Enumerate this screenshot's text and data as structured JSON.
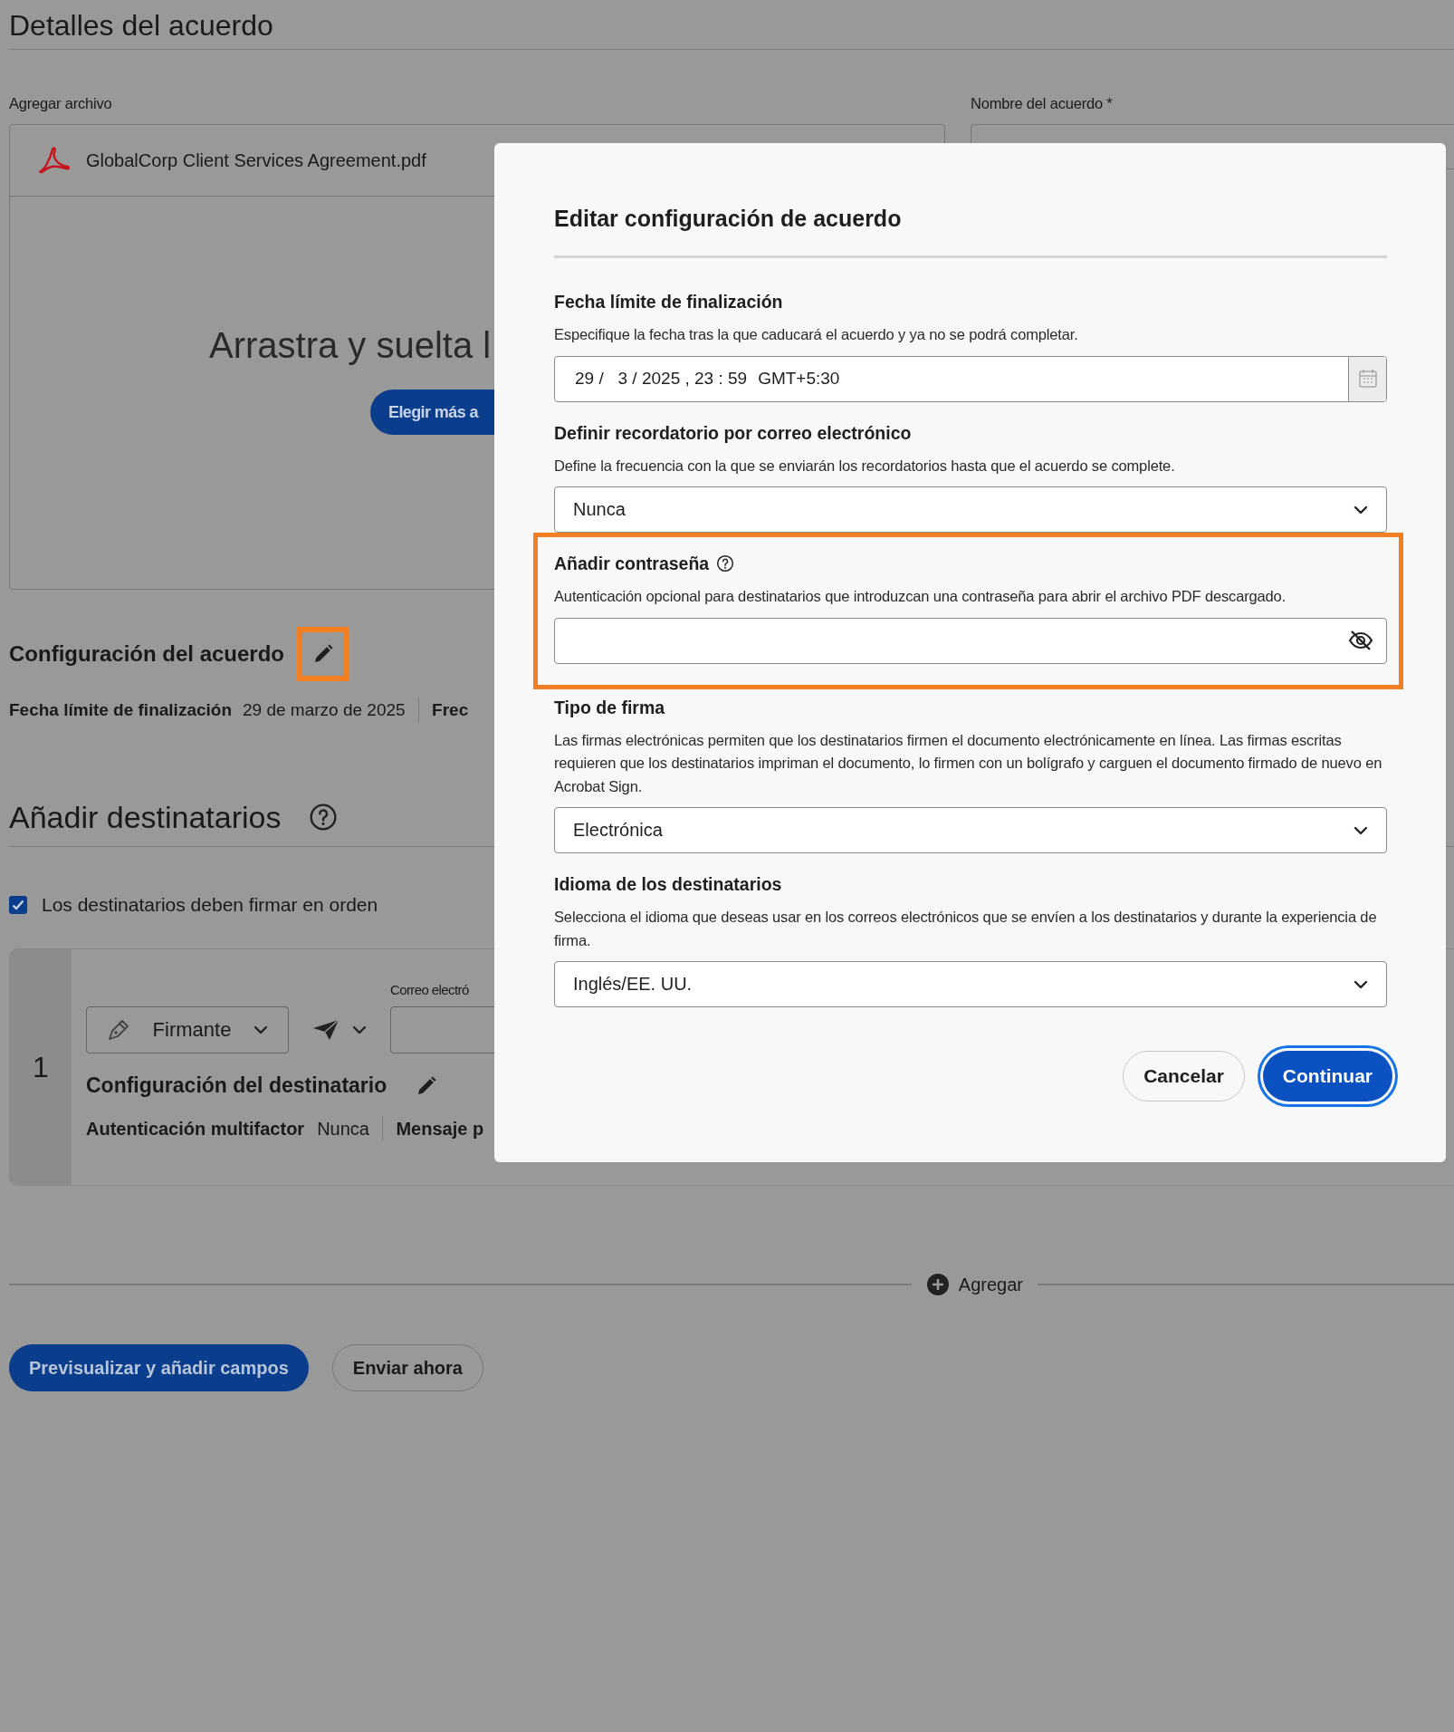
{
  "page": {
    "title": "Detalles del acuerdo"
  },
  "file_upload": {
    "label": "Agregar archivo",
    "file_name": "GlobalCorp Client Services Agreement.pdf",
    "drop_text": "Arrastra y suelta l",
    "choose_button": "Elegir más a"
  },
  "agreement_name": {
    "label": "Nombre del acuerdo",
    "required_mark": "*"
  },
  "agreement_settings": {
    "title": "Configuración del acuerdo",
    "highlighted": true,
    "details": [
      {
        "label": "Fecha límite de finalización",
        "value": "29 de marzo de 2025"
      },
      {
        "label": "Frec"
      }
    ]
  },
  "recipients": {
    "title": "Añadir destinatarios",
    "sign_in_order": {
      "label": "Los destinatarios deben firmar en orden",
      "checked": true
    },
    "items": [
      {
        "number": "1",
        "role": "Firmante",
        "email_label": "Correo electró",
        "settings_title": "Configuración del destinatario",
        "details": [
          {
            "label": "Autenticación multifactor",
            "value": "Nunca"
          },
          {
            "label": "Mensaje p"
          }
        ]
      }
    ],
    "add_button": "Agregar"
  },
  "actions": [
    {
      "label": "Previsualizar y añadir campos",
      "kind": "primary"
    },
    {
      "label": "Enviar ahora",
      "kind": "secondary"
    }
  ],
  "dialog": {
    "title": "Editar configuración de acuerdo",
    "sections": [
      {
        "kind": "datetime",
        "label": "Fecha límite de finalización",
        "description": "Especifique la fecha tras la que caducará el acuerdo y ya no se podrá completar.",
        "value": "29 /   3 / 2025 , 23 : 59",
        "timezone": "GMT+5:30"
      },
      {
        "kind": "select",
        "label": "Definir recordatorio por correo electrónico",
        "description": "Define la frecuencia con la que se enviarán los recordatorios hasta que el acuerdo se complete.",
        "value": "Nunca"
      },
      {
        "kind": "password",
        "label": "Añadir contraseña",
        "description": "Autenticación opcional para destinatarios que introduzcan una contraseña para abrir el archivo PDF descargado.",
        "highlighted": true
      },
      {
        "kind": "select",
        "label": "Tipo de firma",
        "description": "Las firmas electrónicas permiten que los destinatarios firmen el documento electrónicamente en línea. Las firmas escritas requieren que los destinatarios impriman el documento, lo firmen con un bolígrafo y carguen el documento firmado de nuevo en Acrobat Sign.",
        "value": "Electrónica"
      },
      {
        "kind": "select",
        "label": "Idioma de los destinatarios",
        "description": "Selecciona el idioma que deseas usar en los correos electrónicos que se envíen a los destinatarios y durante la experiencia de firma.",
        "value": "Inglés/EE. UU."
      }
    ],
    "buttons": [
      {
        "label": "Cancelar",
        "kind": "secondary",
        "focused": false
      },
      {
        "label": "Continuar",
        "kind": "primary",
        "focused": true
      }
    ]
  }
}
